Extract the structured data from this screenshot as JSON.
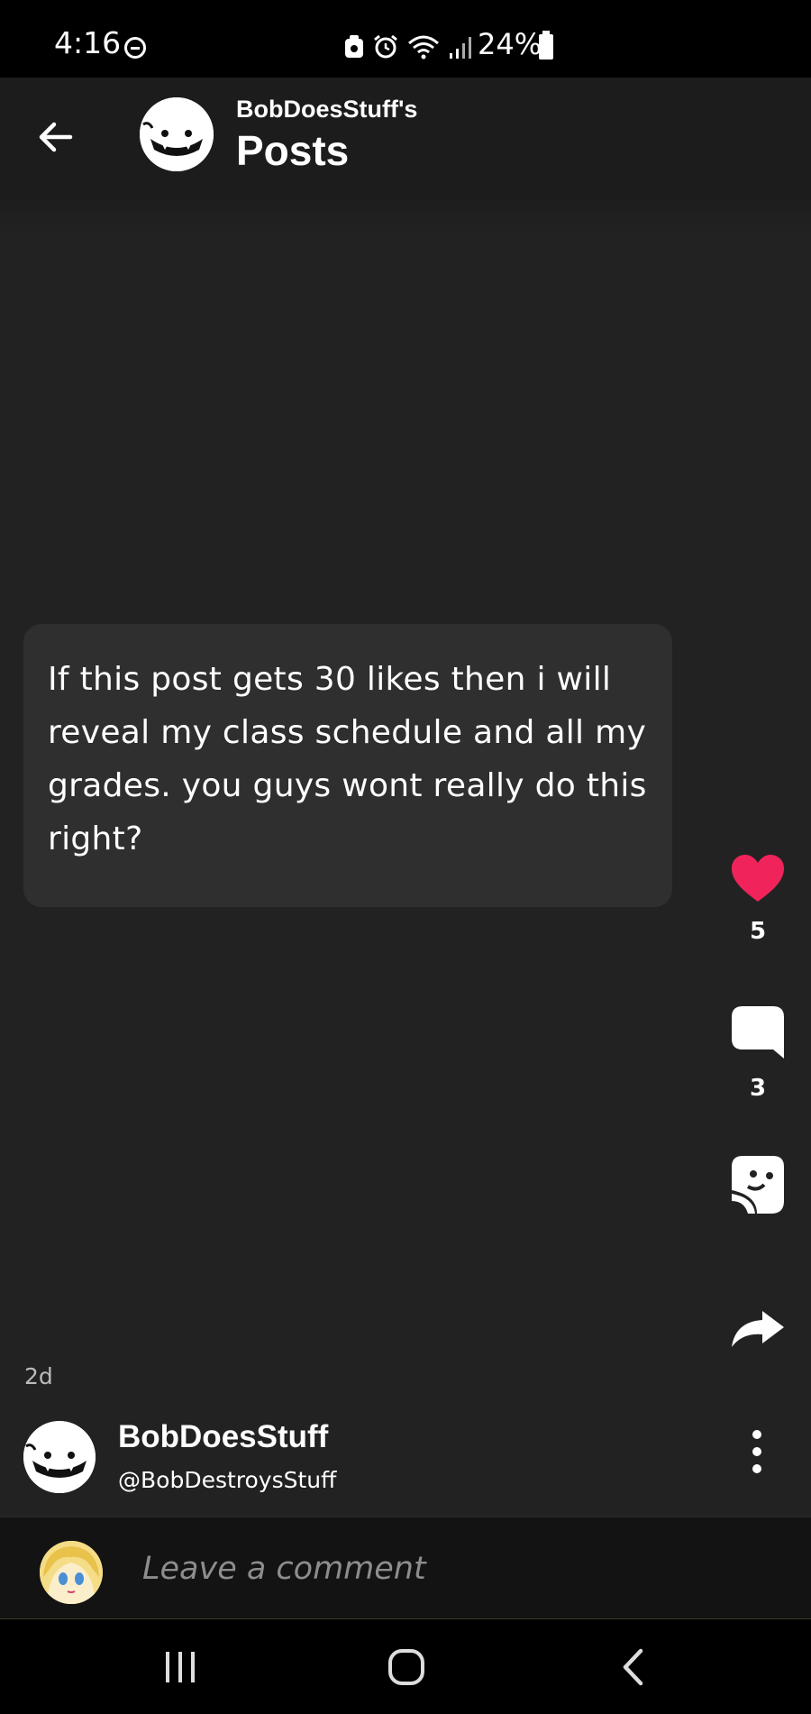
{
  "status_bar": {
    "time": "4:16",
    "battery": "24%"
  },
  "header": {
    "subtitle": "BobDoesStuff's",
    "title": "Posts"
  },
  "post": {
    "text": "If this post gets 30 likes then i will reveal my class schedule and all my grades. you guys wont really do this right?",
    "likes": "5",
    "comments": "3",
    "age": "2d",
    "author": {
      "name": "BobDoesStuff",
      "handle": "@BobDestroysStuff"
    }
  },
  "comment_bar": {
    "placeholder": "Leave a comment"
  },
  "colors": {
    "background": "#222223",
    "card": "#2f2f30",
    "like": "#f0245a",
    "status_bar": "#000000"
  },
  "icons": {
    "back": "arrow-left-icon",
    "like": "heart-icon",
    "comment": "speech-bubble-icon",
    "sticker": "sticker-icon",
    "share": "share-arrow-icon",
    "more": "vertical-dots-icon"
  }
}
